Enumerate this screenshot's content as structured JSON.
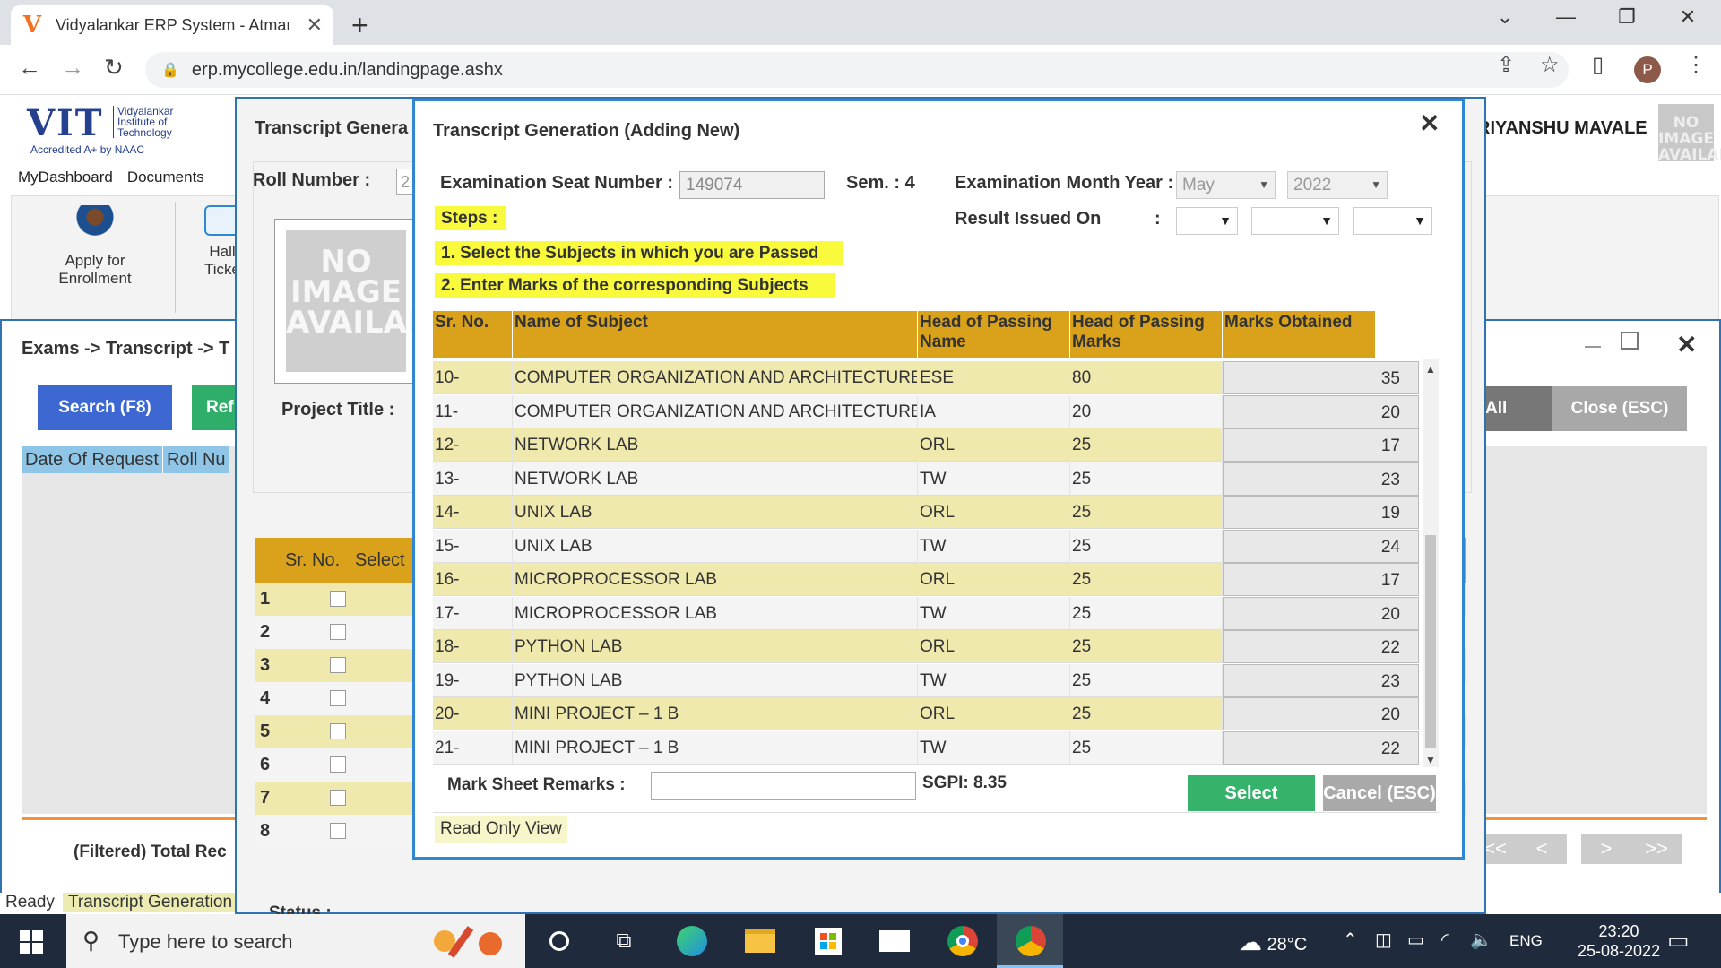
{
  "browser": {
    "tab_title": "Vidyalankar ERP System - Atmanirbhar",
    "tab_logo": "V",
    "url": "erp.mycollege.edu.in/landingpage.ashx",
    "profile_initial": "P"
  },
  "app": {
    "logo": {
      "big": "VIT",
      "sub1": "Vidyalankar",
      "sub2": "Institute of",
      "sub3": "Technology",
      "accreditation": "Accredited A+ by NAAC"
    },
    "menu": [
      "MyDashboard",
      "Documents"
    ],
    "ribbon": {
      "apply_line1": "Apply for",
      "apply_line2": "Enrollment",
      "hall_line1": "Hall",
      "hall_line2": "Ticke"
    },
    "user_name": "RIYANSHU MAVALE",
    "no_image_text": "NO IMAGE AVAILABLE"
  },
  "exams_window": {
    "title": "Exams -> Transcript -> T",
    "search_label": "Search (F8)",
    "refresh_label": "Ref",
    "all_label": "All",
    "close_label": "Close (ESC)",
    "columns": [
      "Date Of Request",
      "Roll Nu"
    ],
    "total_label": "(Filtered) Total Rec",
    "pager": [
      "<<",
      "<",
      ">",
      ">>"
    ]
  },
  "status": {
    "ready": "Ready",
    "transcript": "Transcript Generation"
  },
  "middle_window": {
    "title": "Transcript Genera",
    "roll_label": "Roll Number :",
    "roll_value": "2",
    "photo_text": "NO IMAGE AVAILABLE",
    "project_label": "Project Title :",
    "grid_sr": "Sr. No.",
    "grid_select": "Select",
    "rows": [
      "1",
      "2",
      "3",
      "4",
      "5",
      "6",
      "7",
      "8"
    ],
    "status_label": "Status :"
  },
  "modal": {
    "title": "Transcript Generation (Adding New)",
    "seat_label": "Examination Seat Number :",
    "seat_value": "149074",
    "sem_label": "Sem. : 4",
    "exam_month_label": "Examination Month Year :",
    "exam_month": "May",
    "exam_year": "2022",
    "result_label": "Result Issued On",
    "result_colon": ":",
    "steps_label": "Steps :",
    "step1": "1. Select the Subjects in which you are Passed",
    "step2": "2. Enter Marks of the corresponding  Subjects",
    "columns": {
      "sr": "Sr. No.",
      "subject": "Name of Subject",
      "hop_name": "Head of Passing Name",
      "hop_marks": "Head of Passing Marks",
      "marks": "Marks Obtained"
    },
    "rows": [
      {
        "sr": "10-",
        "subject": "COMPUTER ORGANIZATION AND ARCHITECTURE",
        "hop": "ESE",
        "max": "80",
        "marks": "35"
      },
      {
        "sr": "11-",
        "subject": "COMPUTER ORGANIZATION AND ARCHITECTURE",
        "hop": "IA",
        "max": "20",
        "marks": "20"
      },
      {
        "sr": "12-",
        "subject": "NETWORK LAB",
        "hop": "ORL",
        "max": "25",
        "marks": "17"
      },
      {
        "sr": "13-",
        "subject": "NETWORK LAB",
        "hop": "TW",
        "max": "25",
        "marks": "23"
      },
      {
        "sr": "14-",
        "subject": "UNIX LAB",
        "hop": "ORL",
        "max": "25",
        "marks": "19"
      },
      {
        "sr": "15-",
        "subject": "UNIX LAB",
        "hop": "TW",
        "max": "25",
        "marks": "24"
      },
      {
        "sr": "16-",
        "subject": "MICROPROCESSOR LAB",
        "hop": "ORL",
        "max": "25",
        "marks": "17"
      },
      {
        "sr": "17-",
        "subject": "MICROPROCESSOR LAB",
        "hop": "TW",
        "max": "25",
        "marks": "20"
      },
      {
        "sr": "18-",
        "subject": "PYTHON LAB",
        "hop": "ORL",
        "max": "25",
        "marks": "22"
      },
      {
        "sr": "19-",
        "subject": "PYTHON LAB",
        "hop": "TW",
        "max": "25",
        "marks": "23"
      },
      {
        "sr": "20-",
        "subject": "MINI PROJECT – 1 B",
        "hop": "ORL",
        "max": "25",
        "marks": "20"
      },
      {
        "sr": "21-",
        "subject": "MINI PROJECT – 1 B",
        "hop": "TW",
        "max": "25",
        "marks": "22"
      }
    ],
    "remarks_label": "Mark Sheet Remarks :",
    "sgpi": "SGPI: 8.35",
    "select_label": "Select",
    "cancel_label": "Cancel (ESC)",
    "readonly_label": "Read Only View"
  },
  "taskbar": {
    "search_placeholder": "Type here to search",
    "weather": "28°C",
    "lang": "ENG",
    "time": "23:20",
    "date": "25-08-2022"
  },
  "colors": {
    "header_gold": "#d9a21a",
    "row_highlight": "#efe9ae",
    "step_yellow": "#fafa3c",
    "select_green": "#36b36b",
    "search_blue": "#3d68d2",
    "window_border": "#2d87d2"
  }
}
